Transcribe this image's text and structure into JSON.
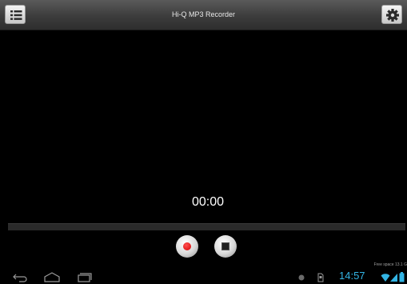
{
  "app": {
    "title": "Hi-Q MP3 Recorder"
  },
  "toolbar": {
    "left_icon": "list-icon",
    "right_icon": "gear-icon"
  },
  "recorder": {
    "timer": "00:00",
    "progress": 0,
    "record_icon": "record-icon",
    "stop_icon": "stop-icon"
  },
  "status": {
    "free_space": "Free space 13.1 G",
    "clock": "14:57"
  },
  "colors": {
    "clock": "#33b5e5",
    "record_red": "#d40000",
    "background": "#000000"
  }
}
